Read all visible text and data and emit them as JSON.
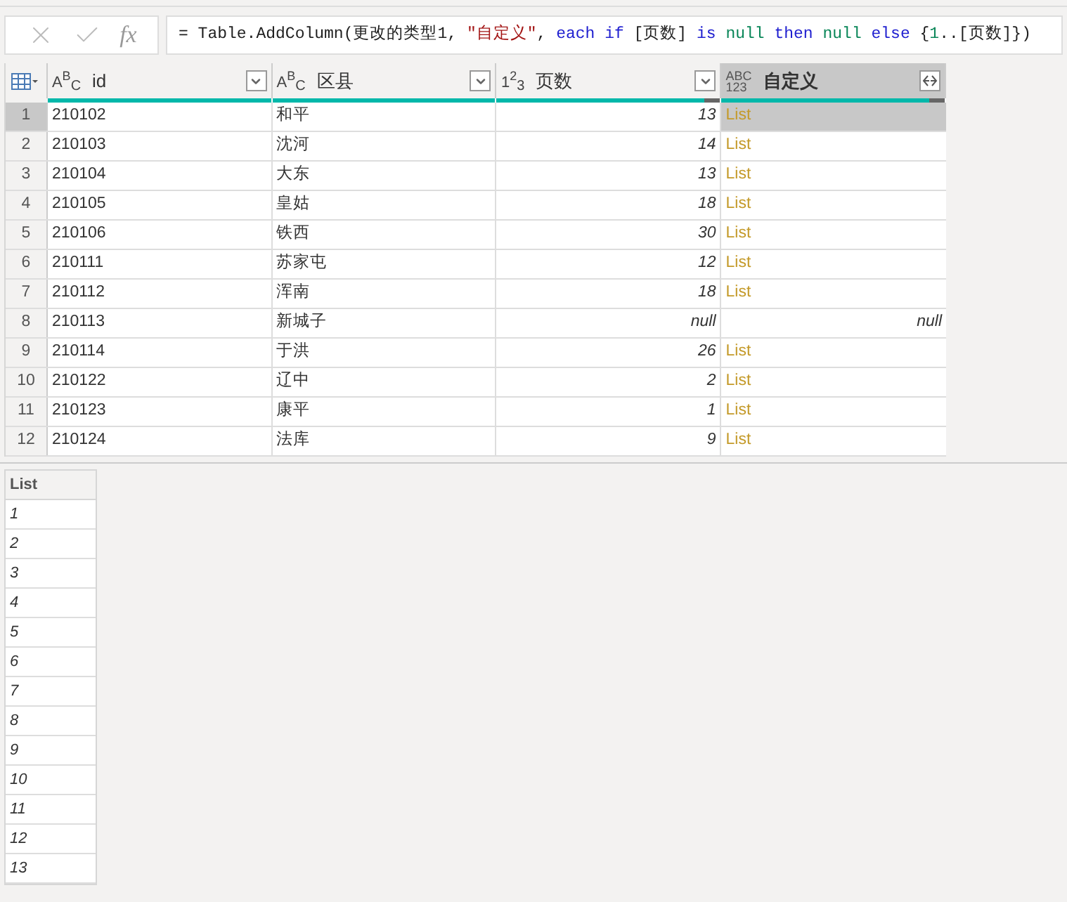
{
  "formula_bar": {
    "fx": "fx",
    "tokens": [
      {
        "kind": "plain",
        "text": "= Table.AddColumn(更改的类型1, "
      },
      {
        "kind": "string",
        "text": "\"自定义\""
      },
      {
        "kind": "plain",
        "text": ", "
      },
      {
        "kind": "keyword",
        "text": "each if"
      },
      {
        "kind": "plain",
        "text": " [页数] "
      },
      {
        "kind": "keyword",
        "text": "is "
      },
      {
        "kind": "literal",
        "text": "null "
      },
      {
        "kind": "keyword",
        "text": "then "
      },
      {
        "kind": "literal",
        "text": "null "
      },
      {
        "kind": "keyword",
        "text": "else"
      },
      {
        "kind": "plain",
        "text": " {"
      },
      {
        "kind": "literal",
        "text": "1"
      },
      {
        "kind": "plain",
        "text": "..[页数]})"
      }
    ]
  },
  "table": {
    "columns": [
      {
        "name": "id",
        "kind": "text",
        "type_icon": [
          "ABC"
        ],
        "header_button": {
          "kind": "filter"
        },
        "selected": false,
        "level": 1
      },
      {
        "name": "区县",
        "kind": "text",
        "type_icon": [
          "ABC"
        ],
        "header_button": {
          "kind": "filter"
        },
        "selected": false,
        "level": 1
      },
      {
        "name": "页数",
        "kind": "number",
        "type_icon": [
          "123"
        ],
        "header_button": {
          "kind": "filter"
        },
        "selected": false,
        "level": 0.93
      },
      {
        "name": "自定义",
        "kind": "any",
        "type_icon": [
          "ABC",
          "123"
        ],
        "header_button": {
          "kind": "expand"
        },
        "selected": true,
        "level": 0.93
      }
    ],
    "rows": [
      {
        "num": "1",
        "id": "210102",
        "district": "和平",
        "pages": "13",
        "custom": {
          "kind": "list",
          "text": "List"
        },
        "selected": true
      },
      {
        "num": "2",
        "id": "210103",
        "district": "沈河",
        "pages": "14",
        "custom": {
          "kind": "list",
          "text": "List"
        },
        "selected": false
      },
      {
        "num": "3",
        "id": "210104",
        "district": "大东",
        "pages": "13",
        "custom": {
          "kind": "list",
          "text": "List"
        },
        "selected": false
      },
      {
        "num": "4",
        "id": "210105",
        "district": "皇姑",
        "pages": "18",
        "custom": {
          "kind": "list",
          "text": "List"
        },
        "selected": false
      },
      {
        "num": "5",
        "id": "210106",
        "district": "铁西",
        "pages": "30",
        "custom": {
          "kind": "list",
          "text": "List"
        },
        "selected": false
      },
      {
        "num": "6",
        "id": "210111",
        "district": "苏家屯",
        "pages": "12",
        "custom": {
          "kind": "list",
          "text": "List"
        },
        "selected": false
      },
      {
        "num": "7",
        "id": "210112",
        "district": "浑南",
        "pages": "18",
        "custom": {
          "kind": "list",
          "text": "List"
        },
        "selected": false
      },
      {
        "num": "8",
        "id": "210113",
        "district": "新城子",
        "pages": "null",
        "custom": {
          "kind": "null",
          "text": "null"
        },
        "selected": false
      },
      {
        "num": "9",
        "id": "210114",
        "district": "于洪",
        "pages": "26",
        "custom": {
          "kind": "list",
          "text": "List"
        },
        "selected": false
      },
      {
        "num": "10",
        "id": "210122",
        "district": "辽中",
        "pages": "2",
        "custom": {
          "kind": "list",
          "text": "List"
        },
        "selected": false
      },
      {
        "num": "11",
        "id": "210123",
        "district": "康平",
        "pages": "1",
        "custom": {
          "kind": "list",
          "text": "List"
        },
        "selected": false
      },
      {
        "num": "12",
        "id": "210124",
        "district": "法库",
        "pages": "9",
        "custom": {
          "kind": "list",
          "text": "List"
        },
        "selected": false
      }
    ]
  },
  "preview": {
    "header": "List",
    "items": [
      "1",
      "2",
      "3",
      "4",
      "5",
      "6",
      "7",
      "8",
      "9",
      "10",
      "11",
      "12",
      "13"
    ]
  }
}
